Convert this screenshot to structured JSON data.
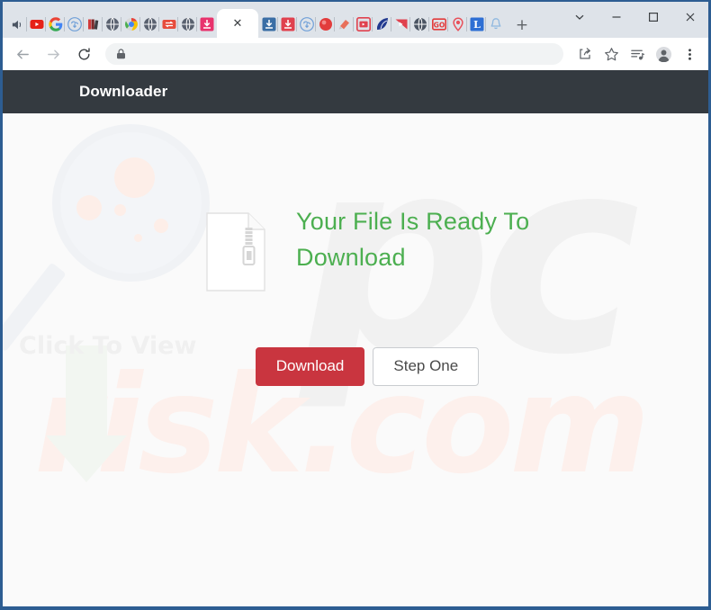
{
  "window": {
    "controls": [
      {
        "name": "tab-search",
        "glyph": "⌄"
      },
      {
        "name": "minimize",
        "glyph": "–"
      },
      {
        "name": "maximize",
        "glyph": "□"
      },
      {
        "name": "close",
        "glyph": "✕"
      }
    ]
  },
  "tabstrip": {
    "pinned_tabs": [
      {
        "name": "speaker-icon",
        "color": "#4b5563",
        "shape": "speaker"
      },
      {
        "name": "youtube-icon",
        "color": "#e62117",
        "shape": "youtube"
      },
      {
        "name": "google-icon",
        "color": "#4285f4",
        "shape": "google"
      },
      {
        "name": "cloud-download-icon",
        "color": "#6f9fd8",
        "shape": "cloud"
      },
      {
        "name": "books-icon",
        "color": "#d13b3b",
        "shape": "books"
      },
      {
        "name": "globe-dark-icon",
        "color": "#5a6270",
        "shape": "globe"
      },
      {
        "name": "chrome-icon",
        "color": "#e8443a",
        "shape": "chrome"
      },
      {
        "name": "globe-dark-icon-2",
        "color": "#5a6270",
        "shape": "globe"
      },
      {
        "name": "swap-icon",
        "color": "#e74c3c",
        "shape": "swap"
      },
      {
        "name": "globe-dark-icon-3",
        "color": "#5a6270",
        "shape": "globe"
      },
      {
        "name": "download-pink-icon",
        "color": "#e8336d",
        "shape": "download"
      }
    ],
    "active_tab": {
      "name": "active-tab",
      "close_glyph": "✕",
      "title": ""
    },
    "trailing_tabs": [
      {
        "name": "download-blue-icon",
        "color": "#3a6ea5",
        "shape": "download"
      },
      {
        "name": "download-red-icon",
        "color": "#e0414e",
        "shape": "download"
      },
      {
        "name": "cloud-download-icon-2",
        "color": "#6f9fd8",
        "shape": "cloud"
      },
      {
        "name": "record-red-icon",
        "color": "#e23c3c",
        "shape": "record"
      },
      {
        "name": "paint-icon",
        "color": "#e8705a",
        "shape": "paint"
      },
      {
        "name": "video-red-icon",
        "color": "#e0414e",
        "shape": "video"
      },
      {
        "name": "blue-leaf-icon",
        "color": "#223a8f",
        "shape": "leaf"
      },
      {
        "name": "play-red-icon",
        "color": "#e0414e",
        "shape": "play"
      },
      {
        "name": "globe-dark-icon-4",
        "color": "#4b5563",
        "shape": "globe"
      },
      {
        "name": "go-icon",
        "color": "#e23c3c",
        "shape": "go",
        "label": "GO"
      },
      {
        "name": "location-pin-icon",
        "color": "#e8505a",
        "shape": "pin"
      },
      {
        "name": "letter-l-icon",
        "color": "#2e6fd4",
        "shape": "letter",
        "label": "L"
      },
      {
        "name": "bell-icon",
        "color": "#8fb8e0",
        "shape": "bell"
      }
    ],
    "new_tab_glyph": "+"
  },
  "toolbar": {
    "back_glyph": "←",
    "forward_glyph": "→",
    "reload_glyph": "⟳",
    "lock_icon": "lock-icon",
    "url": "",
    "url_placeholder": "",
    "share_glyph": "↱",
    "bookmark_glyph": "☆",
    "reading_list_glyph": "≡",
    "profile_glyph": "●",
    "menu_glyph": "⋮"
  },
  "site": {
    "brand": "Downloader",
    "header_bg": "#343a40"
  },
  "main": {
    "file_icon_name": "zip-file-icon",
    "heading": "Your File Is Ready To Download",
    "heading_color": "#4caf50",
    "download_button": "Download",
    "download_button_color": "#c9353f",
    "step_button": "Step One"
  },
  "watermark": {
    "logo_text": "pc",
    "domain_text": "risk.com",
    "tagline": "Click To View"
  }
}
